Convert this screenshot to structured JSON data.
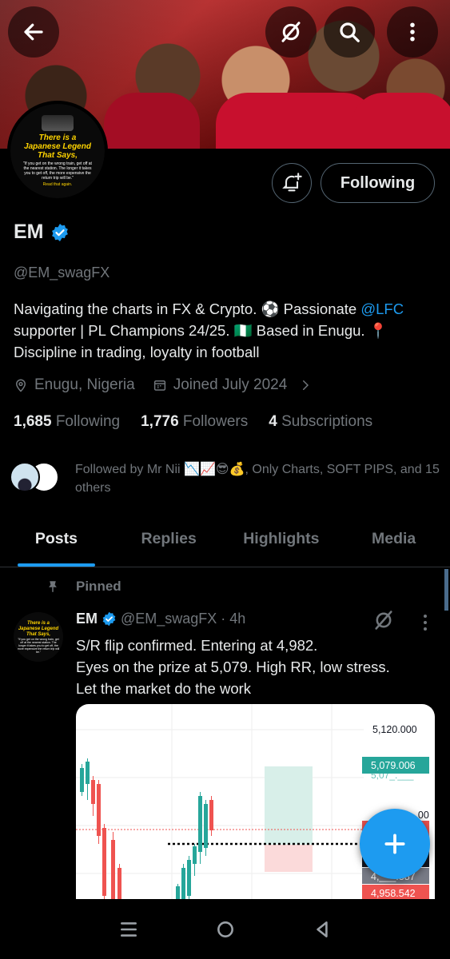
{
  "profile": {
    "name": "EM",
    "handle": "@EM_swagFX",
    "bio_part1": "Navigating the charts in FX & Crypto. ⚽ Passionate ",
    "bio_link": "@LFC",
    "bio_part2": " supporter | PL Champions 24/25. 🇳🇬 Based in Enugu. 📍 Discipline in trading, loyalty in football",
    "location": "Enugu, Nigeria",
    "joined": "Joined July 2024",
    "following_count": "1,685",
    "following_label": "Following",
    "followers_count": "1,776",
    "followers_label": "Followers",
    "subscriptions_count": "4",
    "subscriptions_label": "Subscriptions",
    "followed_by": "Followed by Mr Nii 📉📈😎💰, Only Charts, SOFT PIPS, and 15 others",
    "follow_button": "Following"
  },
  "avatar": {
    "title": "There is a Japanese Legend That Says,",
    "text": "\"If you get on the wrong train, get off at the nearest station. The longer it takes you to get off, the more expensive the return trip will be.\"",
    "foot": "Read that again."
  },
  "tabs": [
    {
      "label": "Posts",
      "active": true
    },
    {
      "label": "Replies",
      "active": false
    },
    {
      "label": "Highlights",
      "active": false
    },
    {
      "label": "Media",
      "active": false
    }
  ],
  "post": {
    "pinned_label": "Pinned",
    "name": "EM",
    "meta": "@EM_swagFX · 4h",
    "line1": "S/R flip confirmed. Entering at 4,982.",
    "line2": "Eyes on the prize at 5,079. High RR, low stress.",
    "line3": "Let the market do the work"
  },
  "chart_data": {
    "type": "candlestick",
    "price_labels": [
      "5,120.000",
      "5,079.006",
      "5,07_.___",
      "__00",
      "4,___.387",
      "4,958.542"
    ],
    "label_1": "5,120.000",
    "label_2": "5,079.006",
    "label_3": "5,07_.___",
    "label_4": "__00",
    "label_5": "4,___.387",
    "label_6": "4,958.542",
    "colors": {
      "up": "#26a69a",
      "down": "#ef5350",
      "target_zone": "#d8efe9",
      "stop_zone": "#fbdada"
    }
  },
  "colors": {
    "accent": "#1d9bf0",
    "text": "#e7e9ea",
    "muted": "#71767b",
    "background": "#000000"
  }
}
